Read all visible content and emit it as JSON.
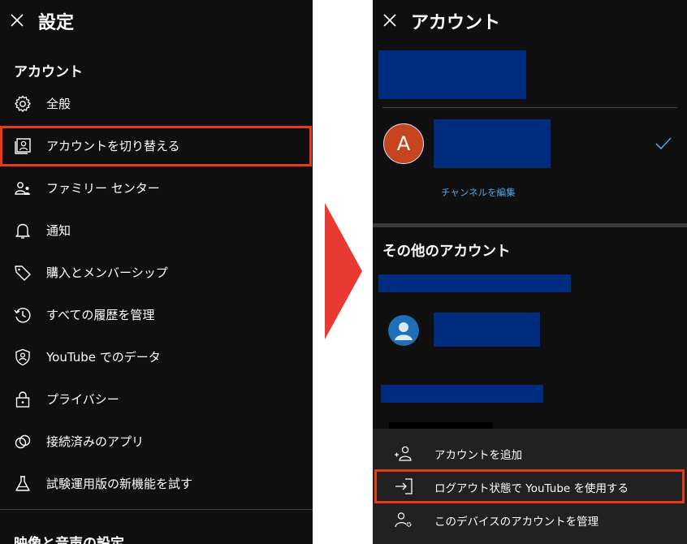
{
  "left": {
    "title": "設定",
    "section_account": "アカウント",
    "items": [
      {
        "label": "全般",
        "icon": "gear-icon"
      },
      {
        "label": "アカウントを切り替える",
        "icon": "switch-account-icon"
      },
      {
        "label": "ファミリー センター",
        "icon": "family-icon"
      },
      {
        "label": "通知",
        "icon": "bell-icon"
      },
      {
        "label": "購入とメンバーシップ",
        "icon": "tag-icon"
      },
      {
        "label": "すべての履歴を管理",
        "icon": "history-icon"
      },
      {
        "label": "YouTube でのデータ",
        "icon": "shield-person-icon"
      },
      {
        "label": "プライバシー",
        "icon": "lock-icon"
      },
      {
        "label": "接続済みのアプリ",
        "icon": "connected-apps-icon"
      },
      {
        "label": "試験運用版の新機能を試す",
        "icon": "flask-icon"
      }
    ],
    "section_next": "映像と音声の設定",
    "highlight_color": "#e8391e"
  },
  "right": {
    "title": "アカウント",
    "current_avatar_letter": "A",
    "edit_channel": "チャンネルを編集",
    "other_accounts": "その他のアカウント",
    "sheet": [
      {
        "label": "アカウントを追加",
        "icon": "add-account-icon"
      },
      {
        "label": "ログアウト状態で YouTube を使用する",
        "icon": "sign-out-icon"
      },
      {
        "label": "このデバイスのアカウントを管理",
        "icon": "manage-accounts-icon"
      }
    ],
    "accent": "#4fa3e8",
    "redaction_color": "#002c80"
  },
  "arrow_color": "#e83a33"
}
